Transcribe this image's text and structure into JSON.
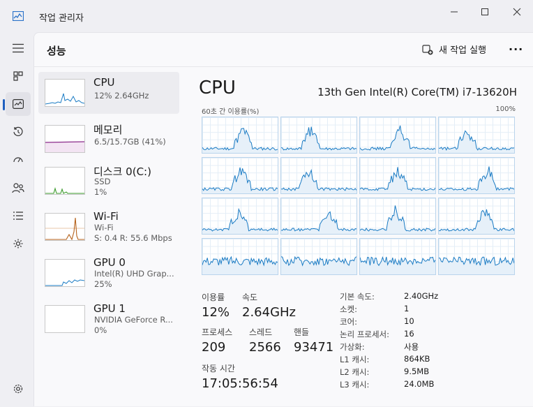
{
  "window": {
    "title": "작업 관리자",
    "minimize_icon": "minimize-icon",
    "maximize_icon": "maximize-icon",
    "close_icon": "close-icon"
  },
  "sidebar": {
    "items": [
      {
        "name": "hamburger-menu-icon"
      },
      {
        "name": "processes-icon"
      },
      {
        "name": "performance-icon",
        "active": true
      },
      {
        "name": "app-history-icon"
      },
      {
        "name": "startup-apps-icon"
      },
      {
        "name": "users-icon"
      },
      {
        "name": "details-icon"
      },
      {
        "name": "services-icon"
      },
      {
        "name": "settings-icon"
      }
    ]
  },
  "header": {
    "title": "성능",
    "run_task_label": "새 작업 실행",
    "more_label": "···"
  },
  "devices": [
    {
      "name": "CPU",
      "line1": "12% 2.64GHz",
      "color": "#1a7bc4"
    },
    {
      "name": "메모리",
      "line1": "6.5/15.7GB (41%)",
      "color": "#8b2a8b"
    },
    {
      "name": "디스크 0(C:)",
      "line1": "SSD",
      "line2": "1%",
      "color": "#3a9a2a"
    },
    {
      "name": "Wi-Fi",
      "line1": "Wi-Fi",
      "line2": "S: 0.4  R: 55.6 Mbps",
      "color": "#b5621b"
    },
    {
      "name": "GPU 0",
      "line1": "Intel(R) UHD Grap...",
      "line2": "25%",
      "color": "#1a7bc4"
    },
    {
      "name": "GPU 1",
      "line1": "NVIDIA GeForce R...",
      "line2": "0%",
      "color": "#1a7bc4"
    }
  ],
  "cpu": {
    "title": "CPU",
    "model": "13th Gen Intel(R) Core(TM) i7-13620H",
    "graph_label": "60초 간 이용률(%)",
    "graph_max": "100%",
    "stats": {
      "util_label": "이용률",
      "util_value": "12%",
      "speed_label": "속도",
      "speed_value": "2.64GHz",
      "proc_label": "프로세스",
      "proc_value": "209",
      "thread_label": "스레드",
      "thread_value": "2566",
      "handle_label": "핸들",
      "handle_value": "93471",
      "uptime_label": "작동 시간",
      "uptime_value": "17:05:56:54"
    },
    "specs": [
      {
        "label": "기본 속도:",
        "value": "2.40GHz"
      },
      {
        "label": "소켓:",
        "value": "1"
      },
      {
        "label": "코어:",
        "value": "10"
      },
      {
        "label": "논리 프로세서:",
        "value": "16"
      },
      {
        "label": "가상화:",
        "value": "사용"
      },
      {
        "label": "L1 캐시:",
        "value": "864KB"
      },
      {
        "label": "L2 캐시:",
        "value": "9.5MB"
      },
      {
        "label": "L3 캐시:",
        "value": "24.0MB"
      }
    ]
  }
}
